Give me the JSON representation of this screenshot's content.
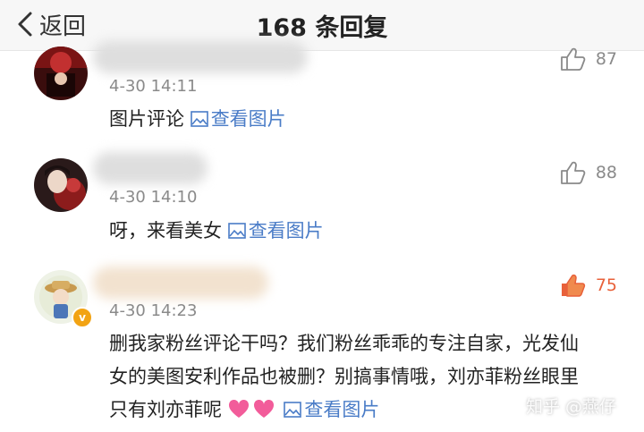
{
  "nav": {
    "back_label": "返回",
    "title": "168 条回复"
  },
  "comments": [
    {
      "time": "4-30 14:11",
      "text": "图片评论",
      "link": "查看图片",
      "likes": "87"
    },
    {
      "time": "4-30 14:10",
      "text": "呀，来看美女",
      "link": "查看图片",
      "likes": "88"
    },
    {
      "time": "4-30 14:23",
      "text": "删我家粉丝评论干吗？我们粉丝乖乖的专注自家，光发仙女的美图安利作品也被删？别搞事情哦，刘亦菲粉丝眼里只有刘亦菲呢",
      "link": "查看图片",
      "likes": "75",
      "verified_mark": "v"
    }
  ],
  "watermark": "知乎 @燕仔",
  "colors": {
    "link": "#4a7cc7",
    "like_active": "#e8613a",
    "verified": "#f2a313",
    "heart": "#f25c9a"
  },
  "icons": {
    "back": "chevron-left-icon",
    "image": "image-icon",
    "like": "thumbs-up-icon",
    "heart": "heart-icon"
  }
}
